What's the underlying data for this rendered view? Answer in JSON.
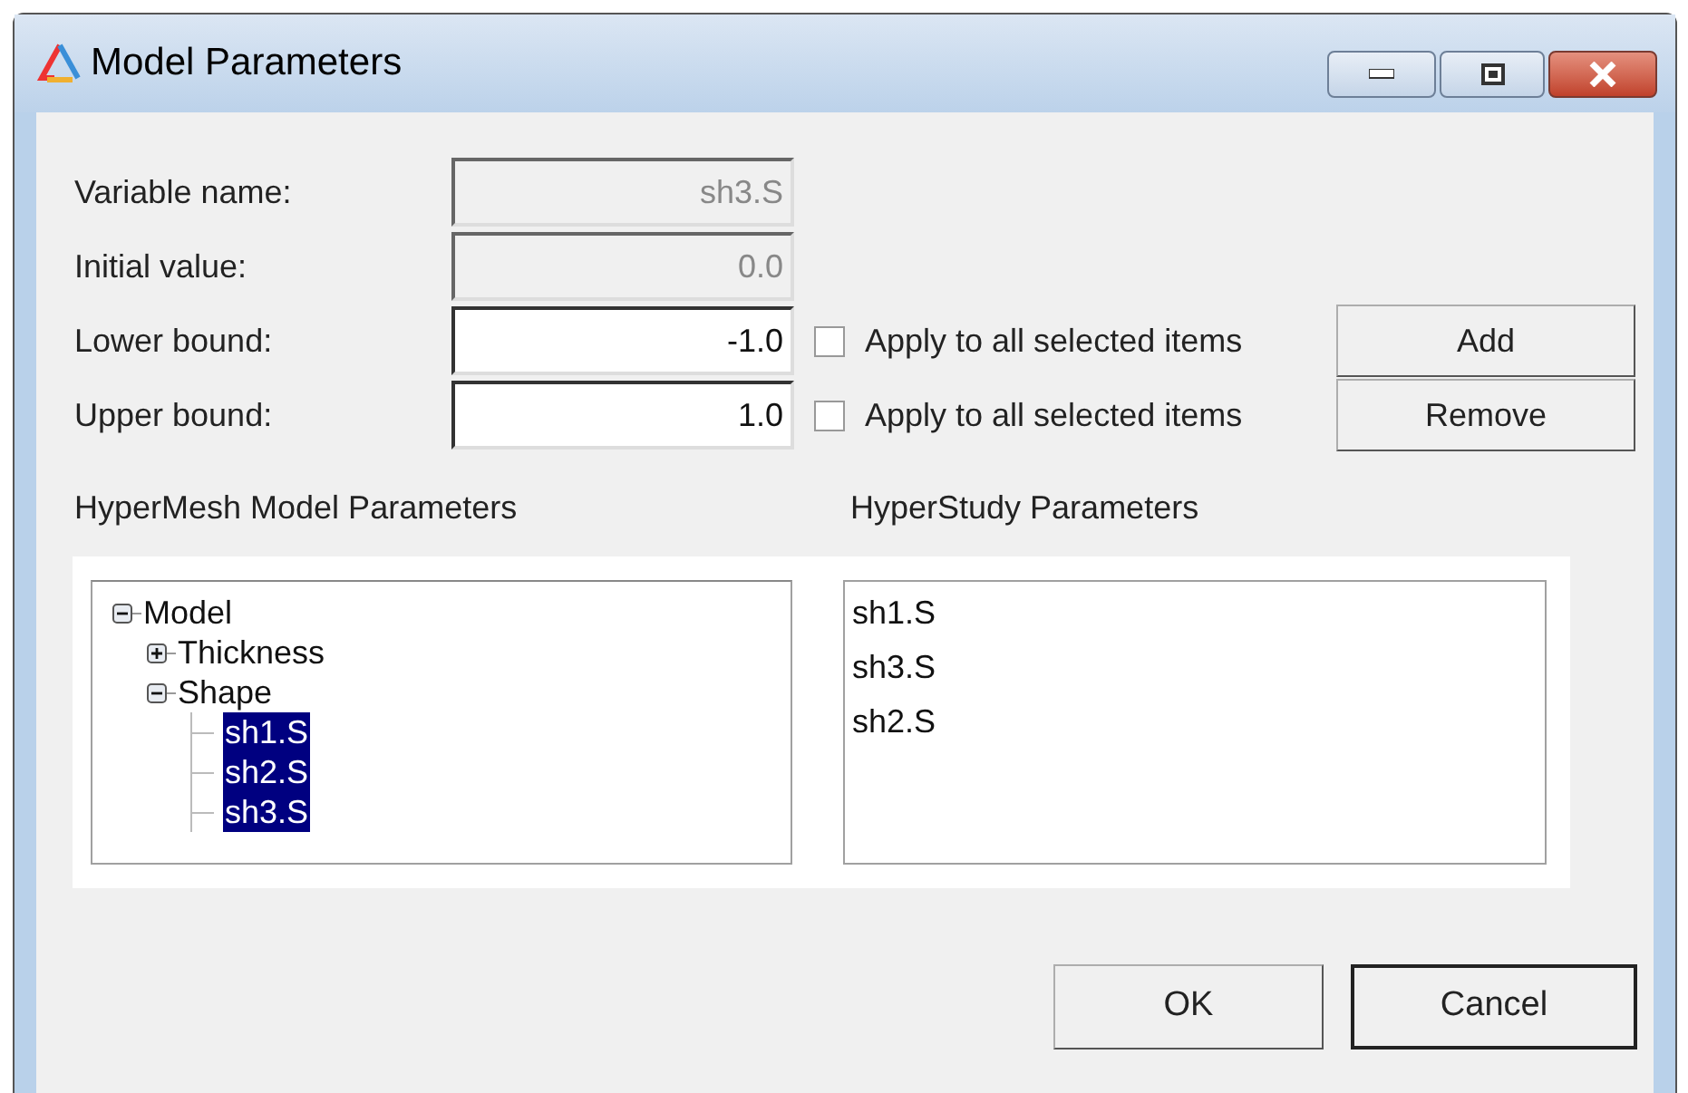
{
  "window": {
    "title": "Model Parameters"
  },
  "fields": [
    {
      "label": "Variable name:",
      "value": "sh3.S",
      "disabled": true
    },
    {
      "label": "Initial value:",
      "value": "0.0",
      "disabled": true
    },
    {
      "label": "Lower bound:",
      "value": "-1.0",
      "disabled": false,
      "apply_all": {
        "label": "Apply to all selected items",
        "checked": false
      },
      "button": "Add"
    },
    {
      "label": "Upper bound:",
      "value": "1.0",
      "disabled": false,
      "apply_all": {
        "label": "Apply to all selected items",
        "checked": false
      },
      "button": "Remove"
    }
  ],
  "model_tree": {
    "title": "HyperMesh Model Parameters",
    "items": [
      {
        "label": "Model",
        "expanded": true,
        "selected": false,
        "children": [
          {
            "label": "Thickness",
            "expanded": false,
            "selected": false
          },
          {
            "label": "Shape",
            "expanded": true,
            "selected": false,
            "children": [
              {
                "label": "sh1.S",
                "selected": true
              },
              {
                "label": "sh2.S",
                "selected": true
              },
              {
                "label": "sh3.S",
                "selected": true
              }
            ]
          }
        ]
      }
    ]
  },
  "study_list": {
    "title": "HyperStudy Parameters",
    "items": [
      "sh1.S",
      "sh3.S",
      "sh2.S"
    ]
  },
  "buttons": [
    {
      "label": "OK",
      "default": false
    },
    {
      "label": "Cancel",
      "default": true
    }
  ]
}
